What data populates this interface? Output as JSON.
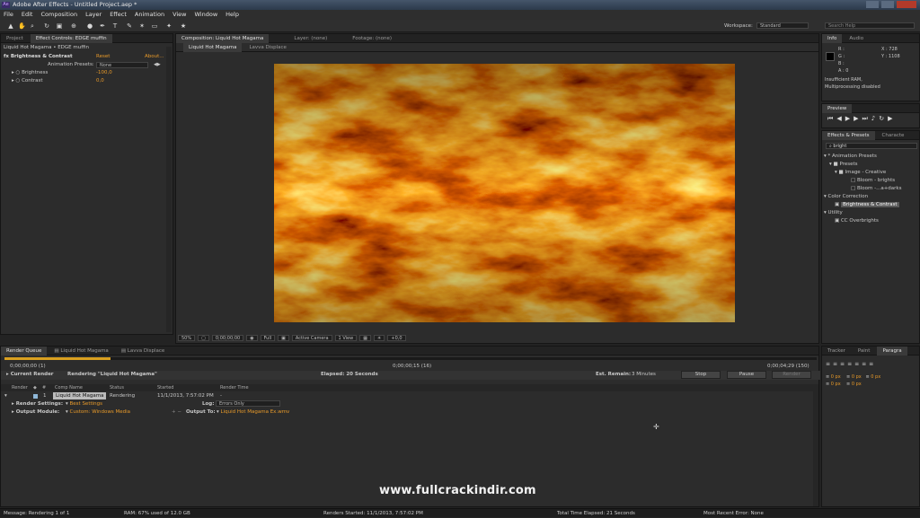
{
  "app": {
    "title": "Adobe After Effects - Untitled Project.aep *",
    "icon": "Ae"
  },
  "menu": [
    "File",
    "Edit",
    "Composition",
    "Layer",
    "Effect",
    "Animation",
    "View",
    "Window",
    "Help"
  ],
  "workspace": {
    "label": "Workspace:",
    "value": "Standard",
    "search_placeholder": "Search Help"
  },
  "left_panel": {
    "tabs": [
      "Project",
      "Effect Controls: EDGE muffin"
    ],
    "header": "Liquid Hot Magama • EDGE muffin",
    "effect": {
      "name": "Brightness & Contrast",
      "reset": "Reset",
      "about": "About...",
      "presets_label": "Animation Presets:",
      "presets_value": "None",
      "props": [
        {
          "name": "Brightness",
          "value": "-100,0"
        },
        {
          "name": "Contrast",
          "value": "0,0"
        }
      ]
    }
  },
  "comp_panel": {
    "tabs": [
      "Composition: Liquid Hot Magama",
      "Layer: (none)",
      "Footage: (none)"
    ],
    "subtabs": [
      "Liquid Hot Magama",
      "Lavva Displace"
    ],
    "bottom": {
      "zoom": "50%",
      "time": "0;00;00;00",
      "resolution": "Full",
      "camera": "Active Camera",
      "view": "1 View",
      "exposure": "+0,0"
    }
  },
  "info_panel": {
    "tabs": [
      "Info",
      "Audio"
    ],
    "rgb": [
      "R :",
      "G :",
      "B :",
      "A : 0"
    ],
    "coords": [
      "X : 728",
      "Y : 1108"
    ],
    "msg1": "Insufficient RAM,",
    "msg2": "Multiprocessing disabled"
  },
  "preview_panel": {
    "tab": "Preview"
  },
  "effects_panel": {
    "tabs": [
      "Effects & Presets",
      "Characte"
    ],
    "search": "bright",
    "tree": [
      {
        "label": "* Animation Presets",
        "indent": 0
      },
      {
        "label": "Presets",
        "indent": 1
      },
      {
        "label": "Image - Creative",
        "indent": 2
      },
      {
        "label": "Bloom - brights",
        "indent": 3
      },
      {
        "label": "Bloom -...a+darks",
        "indent": 3
      },
      {
        "label": "Color Correction",
        "indent": 0
      },
      {
        "label": "Brightness & Contrast",
        "indent": 1,
        "selected": true
      },
      {
        "label": "Utility",
        "indent": 0
      },
      {
        "label": "CC Overbrights",
        "indent": 1
      }
    ]
  },
  "para_panel": {
    "tabs": [
      "Tracker",
      "Paint",
      "Paragra"
    ],
    "fields": [
      "0 px",
      "0 px",
      "0 px",
      "0 px",
      "0 px"
    ]
  },
  "render_queue": {
    "tabs": [
      "Render Queue",
      "Liquid Hot Magama",
      "Lavva Displace"
    ],
    "time_start": "0;00;00;00 (1)",
    "time_mid": "0;00;00;15 (16)",
    "time_end": "0;00;04;29 (150)",
    "current_render": "Current Render",
    "rendering": "Rendering \"Liquid Hot Magama\"",
    "elapsed": "Elapsed: 20 Seconds",
    "remain_label": "Est. Remain:",
    "remain_value": "3 Minutes",
    "stop": "Stop",
    "pause": "Pause",
    "render": "Render",
    "cols": [
      "Render",
      "#",
      "Comp Name",
      "Status",
      "Started",
      "Render Time"
    ],
    "row": {
      "num": "1",
      "comp": "Liquid Hot Magama",
      "status": "Rendering",
      "started": "11/1/2013, 7:57:02 PM",
      "time": "-"
    },
    "render_settings_label": "Render Settings:",
    "render_settings_value": "Best Settings",
    "log_label": "Log:",
    "log_value": "Errors Only",
    "output_module_label": "Output Module:",
    "output_module_value": "Custom: Windows Media",
    "output_to_label": "Output To:",
    "output_to_value": "Liquid Hot Magama Ex.wmv"
  },
  "watermark": "www.fullcrackindir.com",
  "status": {
    "message": "Message:  Rendering 1 of 1",
    "ram": "RAM:  67% used of 12.0 GB",
    "renders_started": "Renders Started:  11/1/2013, 7:57:02 PM",
    "total_elapsed": "Total Time Elapsed:  21 Seconds",
    "recent_error": "Most Recent Error:  None"
  },
  "colors": {
    "accent": "#e89a2a",
    "link": "#6aa0e0",
    "progress": "#d9a020"
  },
  "render_progress": 0.13
}
